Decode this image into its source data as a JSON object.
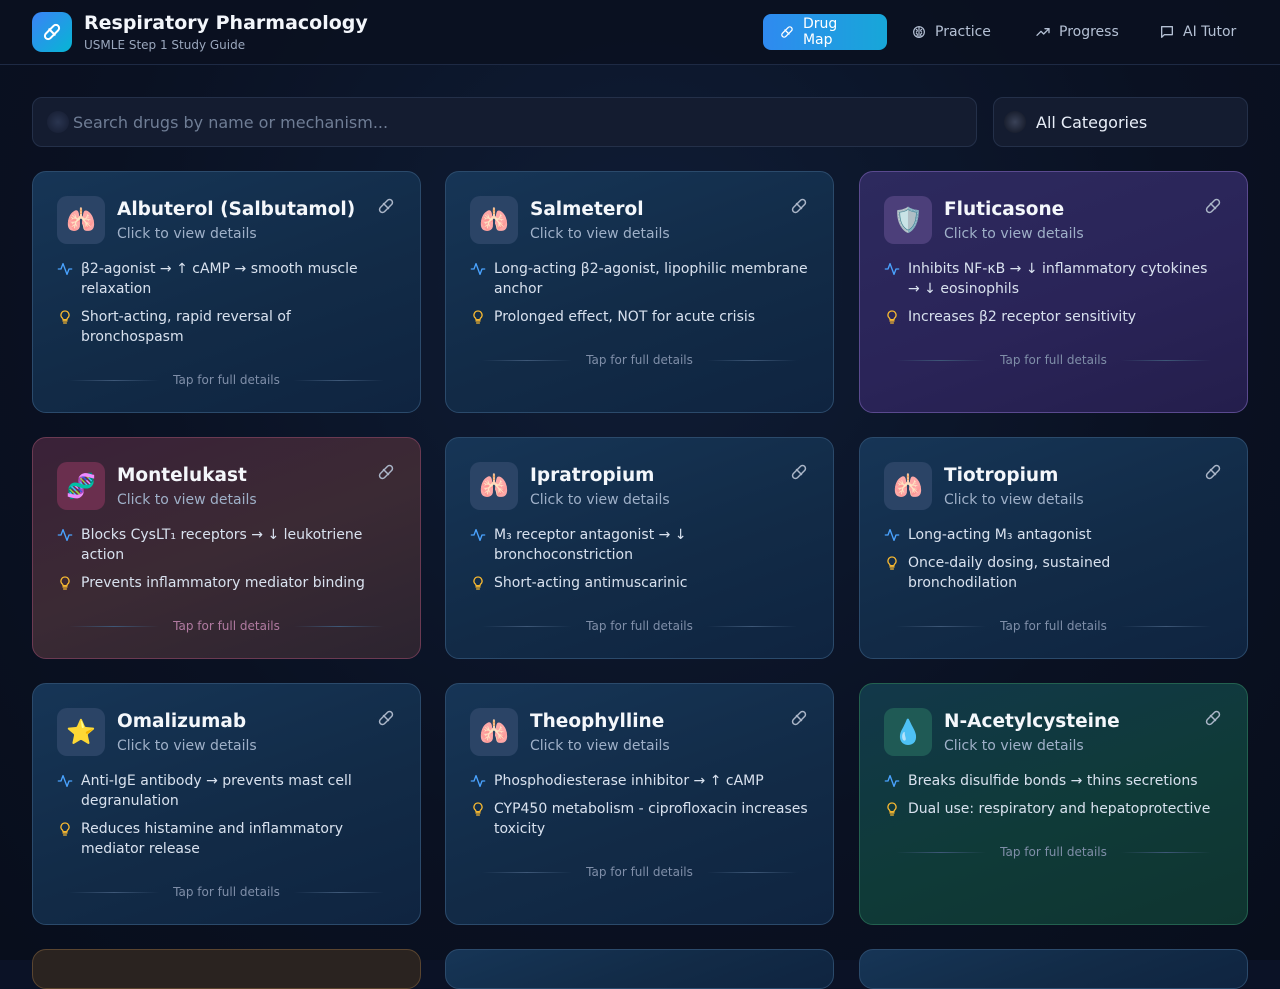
{
  "app": {
    "title": "Respiratory Pharmacology",
    "subtitle": "USMLE Step 1 Study Guide"
  },
  "nav": [
    {
      "label": "Drug Map",
      "icon": "pill-icon",
      "active": true
    },
    {
      "label": "Practice",
      "icon": "brain-icon",
      "active": false
    },
    {
      "label": "Progress",
      "icon": "trending-up-icon",
      "active": false
    },
    {
      "label": "AI Tutor",
      "icon": "chat-icon",
      "active": false
    }
  ],
  "search": {
    "placeholder": "Search drugs by name or mechanism...",
    "value": ""
  },
  "filter": {
    "selected": "All Categories"
  },
  "card_common": {
    "subtitle": "Click to view details",
    "tap": "Tap for full details"
  },
  "cards": [
    {
      "name": "Albuterol (Salbutamol)",
      "emoji": "🫁",
      "theme": "blue",
      "mechanism": "β2-agonist → ↑ cAMP → smooth muscle relaxation",
      "note": "Short-acting, rapid reversal of bronchospasm"
    },
    {
      "name": "Salmeterol",
      "emoji": "🫁",
      "theme": "blue",
      "mechanism": "Long-acting β2-agonist, lipophilic membrane anchor",
      "note": "Prolonged effect, NOT for acute crisis"
    },
    {
      "name": "Fluticasone",
      "emoji": "🛡️",
      "theme": "purple",
      "mechanism": "Inhibits NF-κB → ↓ inflammatory cytokines → ↓ eosinophils",
      "note": "Increases β2 receptor sensitivity"
    },
    {
      "name": "Montelukast",
      "emoji": "🧬",
      "theme": "maroon",
      "mechanism": "Blocks CysLT₁ receptors → ↓ leukotriene action",
      "note": "Prevents inflammatory mediator binding"
    },
    {
      "name": "Ipratropium",
      "emoji": "🫁",
      "theme": "blue",
      "mechanism": "M₃ receptor antagonist → ↓ bronchoconstriction",
      "note": "Short-acting antimuscarinic"
    },
    {
      "name": "Tiotropium",
      "emoji": "🫁",
      "theme": "blue",
      "mechanism": "Long-acting M₃ antagonist",
      "note": "Once-daily dosing, sustained bronchodilation"
    },
    {
      "name": "Omalizumab",
      "emoji": "⭐",
      "theme": "blue",
      "mechanism": "Anti-IgE antibody → prevents mast cell degranulation",
      "note": "Reduces histamine and inflammatory mediator release"
    },
    {
      "name": "Theophylline",
      "emoji": "🫁",
      "theme": "blue",
      "mechanism": "Phosphodiesterase inhibitor → ↑ cAMP",
      "note": "CYP450 metabolism - ciprofloxacin increases toxicity"
    },
    {
      "name": "N-Acetylcysteine",
      "emoji": "💧",
      "theme": "green",
      "mechanism": "Breaks disulfide bonds → thins secretions",
      "note": "Dual use: respiratory and hepatoprotective"
    }
  ],
  "colors": {
    "accent": "#2f8af0",
    "activity_icon": "#4aa3ff",
    "bulb_icon": "#f5b731"
  }
}
